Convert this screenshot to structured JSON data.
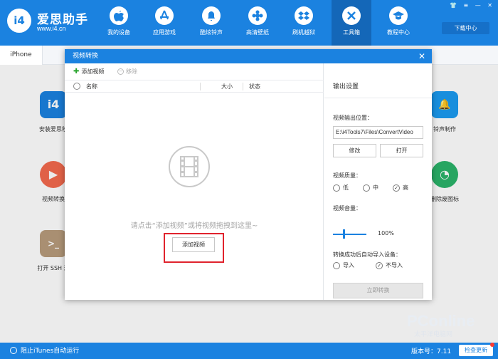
{
  "app": {
    "brand_name": "爱思助手",
    "brand_url": "www.i4.cn",
    "logo_text": "i4",
    "accent": "#1b82e0",
    "window_controls": [
      "👕",
      "≡",
      "—",
      "✕"
    ],
    "download_center": "下载中心"
  },
  "nav": [
    {
      "label": "我的设备",
      "icon": "apple-icon"
    },
    {
      "label": "应用游戏",
      "icon": "app-store-icon"
    },
    {
      "label": "酷炫铃声",
      "icon": "bell-icon"
    },
    {
      "label": "高清壁纸",
      "icon": "flower-icon"
    },
    {
      "label": "刷机越狱",
      "icon": "dropbox-icon"
    },
    {
      "label": "工具箱",
      "icon": "tools-icon",
      "active": true
    },
    {
      "label": "教程中心",
      "icon": "graduation-icon"
    }
  ],
  "tabs": {
    "iphone": "iPhone"
  },
  "background_apps": [
    {
      "label": "安装爱思移",
      "color": "#1b82e0",
      "glyph": "i4"
    },
    {
      "label": "视频转换",
      "color": "#f46a4e",
      "glyph": "▶"
    },
    {
      "label": "打开 SSH 通",
      "color": "#b89c7c",
      "glyph": ">_"
    },
    {
      "label": "铃声制作",
      "color": "#1b9bf0",
      "glyph": "🔔"
    },
    {
      "label": "删除废图标",
      "color": "#2bb46a",
      "glyph": "◔"
    }
  ],
  "modal": {
    "title": "视频转换",
    "close": "✕",
    "toolbar": {
      "add": "添加视频",
      "remove": "移除"
    },
    "table": {
      "col_name": "名称",
      "col_size": "大小",
      "col_status": "状态"
    },
    "empty_hint": "请点击“添加视频”或将视频拖拽到这里~",
    "add_video_button": "添加视频",
    "settings": {
      "title": "输出设置",
      "output_location_label": "视频输出位置：",
      "output_path": "E:\\i4Tools7\\Files\\ConvertVideo",
      "modify": "修改",
      "open": "打开",
      "quality_label": "视频质量：",
      "quality_options": [
        "低",
        "中",
        "高"
      ],
      "quality_selected": "高",
      "volume_label": "视频音量：",
      "volume_value": "100%",
      "auto_import_label": "转换成功后自动导入设备：",
      "auto_import_options": [
        "导入",
        "不导入"
      ],
      "auto_import_selected": "不导入",
      "convert_now": "立即转换"
    }
  },
  "statusbar": {
    "itunes_toggle": "阻止iTunes自动运行",
    "version": "版本号：7.11",
    "check_update": "检查更新"
  },
  "watermark": {
    "main": "PConline",
    "sub": "太平洋电脑网"
  }
}
